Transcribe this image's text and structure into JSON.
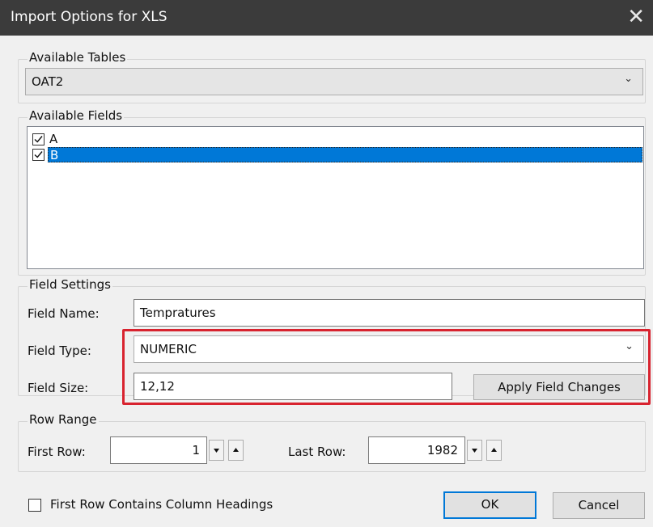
{
  "window": {
    "title": "Import Options for XLS",
    "close_glyph": "✕"
  },
  "available_tables": {
    "group_label": "Available Tables",
    "selected": "OAT2",
    "chevron": "⌄"
  },
  "available_fields": {
    "group_label": "Available Fields",
    "items": [
      {
        "label": "A",
        "checked": true,
        "selected": false
      },
      {
        "label": "B",
        "checked": true,
        "selected": true
      }
    ]
  },
  "field_settings": {
    "group_label": "Field Settings",
    "name_label": "Field Name:",
    "name_value": "Tempratures",
    "type_label": "Field Type:",
    "type_value": "NUMERIC",
    "size_label": "Field Size:",
    "size_value": "12,12",
    "apply_label": "Apply Field Changes"
  },
  "row_range": {
    "group_label": "Row Range",
    "first_label": "First Row:",
    "first_value": "1",
    "last_label": "Last Row:",
    "last_value": "1982"
  },
  "footer": {
    "headings_label": "First Row Contains Column Headings",
    "headings_checked": false,
    "ok_label": "OK",
    "cancel_label": "Cancel"
  },
  "colors": {
    "selection": "#0078d7",
    "highlight_box": "#d8232f",
    "titlebar": "#3b3b3b"
  }
}
